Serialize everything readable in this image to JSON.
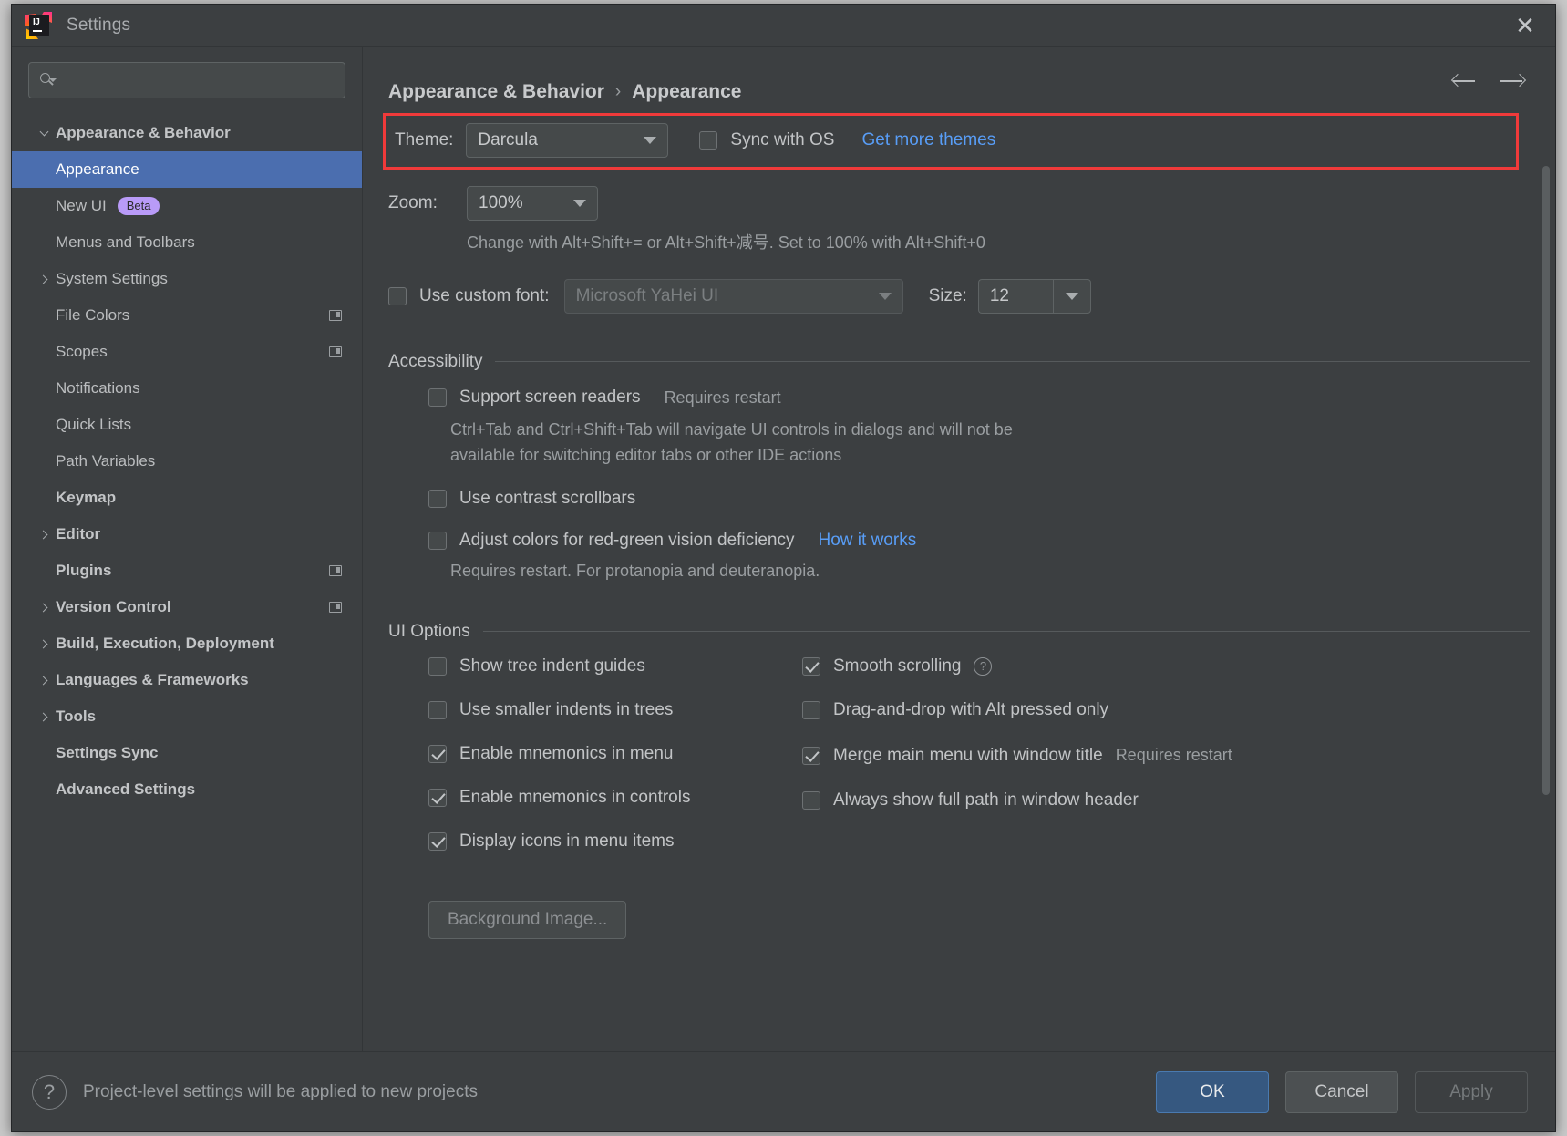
{
  "window": {
    "title": "Settings",
    "close_label": "✕",
    "app_icon": "intellij-idea-icon"
  },
  "search": {
    "value": "",
    "placeholder": ""
  },
  "sidebar": {
    "items": [
      {
        "label": "Appearance & Behavior",
        "indent": 0,
        "arrow": "down",
        "bold": true,
        "selected": false,
        "badge": null,
        "project_icon": false
      },
      {
        "label": "Appearance",
        "indent": 1,
        "arrow": "none",
        "bold": false,
        "selected": true,
        "badge": null,
        "project_icon": false
      },
      {
        "label": "New UI",
        "indent": 1,
        "arrow": "none",
        "bold": false,
        "selected": false,
        "badge": "Beta",
        "project_icon": false
      },
      {
        "label": "Menus and Toolbars",
        "indent": 1,
        "arrow": "none",
        "bold": false,
        "selected": false,
        "badge": null,
        "project_icon": false
      },
      {
        "label": "System Settings",
        "indent": 1,
        "arrow": "right",
        "bold": false,
        "selected": false,
        "badge": null,
        "project_icon": false
      },
      {
        "label": "File Colors",
        "indent": 1,
        "arrow": "none",
        "bold": false,
        "selected": false,
        "badge": null,
        "project_icon": true
      },
      {
        "label": "Scopes",
        "indent": 1,
        "arrow": "none",
        "bold": false,
        "selected": false,
        "badge": null,
        "project_icon": true
      },
      {
        "label": "Notifications",
        "indent": 1,
        "arrow": "none",
        "bold": false,
        "selected": false,
        "badge": null,
        "project_icon": false
      },
      {
        "label": "Quick Lists",
        "indent": 1,
        "arrow": "none",
        "bold": false,
        "selected": false,
        "badge": null,
        "project_icon": false
      },
      {
        "label": "Path Variables",
        "indent": 1,
        "arrow": "none",
        "bold": false,
        "selected": false,
        "badge": null,
        "project_icon": false
      },
      {
        "label": "Keymap",
        "indent": 0,
        "arrow": "none",
        "bold": true,
        "selected": false,
        "badge": null,
        "project_icon": false
      },
      {
        "label": "Editor",
        "indent": 0,
        "arrow": "right",
        "bold": true,
        "selected": false,
        "badge": null,
        "project_icon": false
      },
      {
        "label": "Plugins",
        "indent": 0,
        "arrow": "none",
        "bold": true,
        "selected": false,
        "badge": null,
        "project_icon": true
      },
      {
        "label": "Version Control",
        "indent": 0,
        "arrow": "right",
        "bold": true,
        "selected": false,
        "badge": null,
        "project_icon": true
      },
      {
        "label": "Build, Execution, Deployment",
        "indent": 0,
        "arrow": "right",
        "bold": true,
        "selected": false,
        "badge": null,
        "project_icon": false
      },
      {
        "label": "Languages & Frameworks",
        "indent": 0,
        "arrow": "right",
        "bold": true,
        "selected": false,
        "badge": null,
        "project_icon": false
      },
      {
        "label": "Tools",
        "indent": 0,
        "arrow": "right",
        "bold": true,
        "selected": false,
        "badge": null,
        "project_icon": false
      },
      {
        "label": "Settings Sync",
        "indent": 0,
        "arrow": "none",
        "bold": true,
        "selected": false,
        "badge": null,
        "project_icon": false
      },
      {
        "label": "Advanced Settings",
        "indent": 0,
        "arrow": "none",
        "bold": true,
        "selected": false,
        "badge": null,
        "project_icon": false
      }
    ]
  },
  "breadcrumb": {
    "parent": "Appearance & Behavior",
    "separator": "›",
    "current": "Appearance"
  },
  "nav": {
    "back": "back-arrow",
    "forward": "forward-arrow"
  },
  "theme_row": {
    "label": "Theme:",
    "value": "Darcula",
    "sync_label": "Sync with OS",
    "sync_checked": false,
    "link": "Get more themes",
    "highlight_color": "#f03a3a"
  },
  "zoom_row": {
    "label": "Zoom:",
    "value": "100%",
    "hint": "Change with Alt+Shift+= or Alt+Shift+减号. Set to 100% with Alt+Shift+0"
  },
  "font_row": {
    "checkbox_label": "Use custom font:",
    "checked": false,
    "font_value": "Microsoft YaHei UI",
    "size_label": "Size:",
    "size_value": "12"
  },
  "accessibility": {
    "title": "Accessibility",
    "screen_readers": {
      "label": "Support screen readers",
      "checked": false,
      "note": "Requires restart"
    },
    "screen_readers_desc_line1": "Ctrl+Tab and Ctrl+Shift+Tab will navigate UI controls in dialogs and will not be",
    "screen_readers_desc_line2": "available for switching editor tabs or other IDE actions",
    "contrast_scrollbars": {
      "label": "Use contrast scrollbars",
      "checked": false
    },
    "red_green": {
      "label": "Adjust colors for red-green vision deficiency",
      "checked": false,
      "link": "How it works",
      "desc": "Requires restart. For protanopia and deuteranopia."
    }
  },
  "ui_options": {
    "title": "UI Options",
    "left": [
      {
        "label": "Show tree indent guides",
        "checked": false,
        "note": null,
        "help": false
      },
      {
        "label": "Use smaller indents in trees",
        "checked": false,
        "note": null,
        "help": false
      },
      {
        "label": "Enable mnemonics in menu",
        "checked": true,
        "note": null,
        "help": false
      },
      {
        "label": "Enable mnemonics in controls",
        "checked": true,
        "note": null,
        "help": false
      },
      {
        "label": "Display icons in menu items",
        "checked": true,
        "note": null,
        "help": false
      }
    ],
    "right": [
      {
        "label": "Smooth scrolling",
        "checked": true,
        "note": null,
        "help": true
      },
      {
        "label": "Drag-and-drop with Alt pressed only",
        "checked": false,
        "note": null,
        "help": false
      },
      {
        "label": "Merge main menu with window title",
        "checked": true,
        "note": "Requires restart",
        "help": false
      },
      {
        "label": "Always show full path in window header",
        "checked": false,
        "note": null,
        "help": false
      }
    ],
    "background_image_button": "Background Image..."
  },
  "footer": {
    "help_icon": "?",
    "note": "Project-level settings will be applied to new projects",
    "ok": "OK",
    "cancel": "Cancel",
    "apply": "Apply"
  }
}
